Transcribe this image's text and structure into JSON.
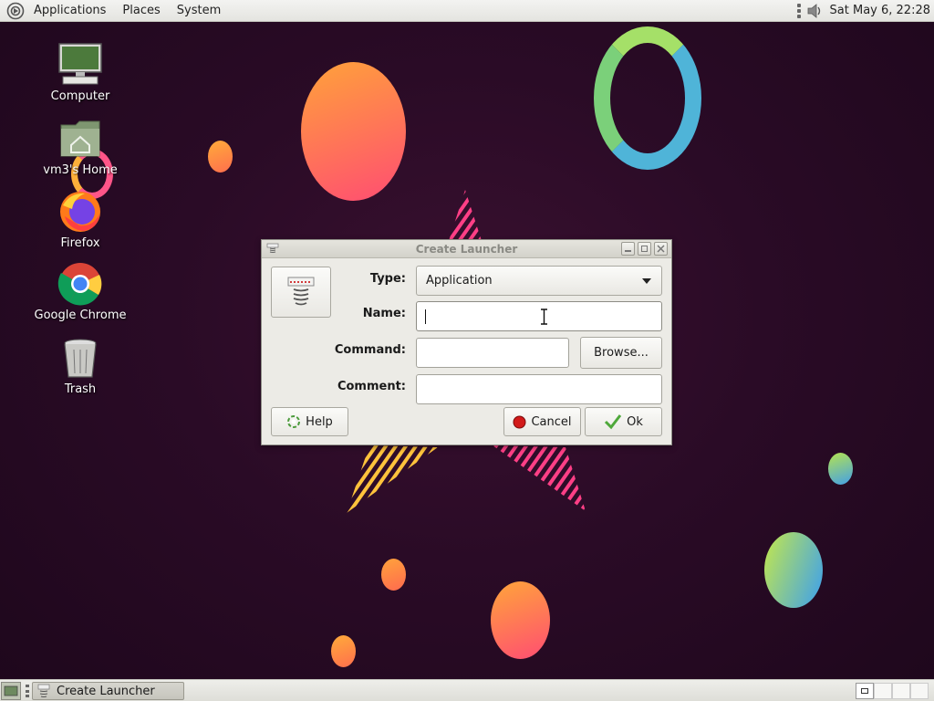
{
  "top_panel": {
    "menus": [
      "Applications",
      "Places",
      "System"
    ],
    "clock": "Sat May  6, 22:28"
  },
  "desktop_icons": [
    {
      "label": "Computer",
      "icon": "computer-icon"
    },
    {
      "label": "vm3's Home",
      "icon": "home-folder-icon"
    },
    {
      "label": "Firefox",
      "icon": "firefox-icon"
    },
    {
      "label": "Google Chrome",
      "icon": "chrome-icon"
    },
    {
      "label": "Trash",
      "icon": "trash-icon"
    }
  ],
  "dialog": {
    "title": "Create Launcher",
    "type_label": "Type:",
    "type_value": "Application",
    "name_label": "Name:",
    "name_value": "",
    "command_label": "Command:",
    "command_value": "",
    "comment_label": "Comment:",
    "comment_value": "",
    "browse_label": "Browse...",
    "help_label": "Help",
    "cancel_label": "Cancel",
    "ok_label": "Ok"
  },
  "bottom_panel": {
    "task_label": "Create Launcher"
  },
  "colors": {
    "panel": "#e9e9e5",
    "dialog_bg": "#ecebe6",
    "wallpaper": "#2a0b26"
  }
}
